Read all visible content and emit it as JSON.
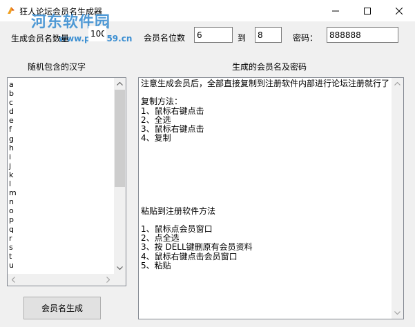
{
  "window": {
    "title": "狂人论坛会员名生成器",
    "watermark": "河东软件园",
    "watermark_url": "www.pc0359.cn"
  },
  "form": {
    "count_label": "生成会员名数量",
    "count_value": "100",
    "digits_label": "会员名位数",
    "digits_min": "6",
    "to_label": "到",
    "digits_max": "8",
    "password_label": "密码：",
    "password_value": "888888"
  },
  "left_panel": {
    "header": "随机包含的汉字",
    "items": [
      "a",
      "b",
      "c",
      "d",
      "e",
      "f",
      "g",
      "h",
      "i",
      "j",
      "k",
      "l",
      "m",
      "n",
      "o",
      "p",
      "q",
      "r",
      "s",
      "t",
      "u"
    ]
  },
  "right_panel": {
    "header": "生成的会员名及密码",
    "lines": [
      "注意生成会员后，全部直接复制到注册软件内部进行论坛注册就行了",
      "",
      "复制方法：",
      "1、鼠标右键点击",
      "2、全选",
      "3、鼠标右键点击",
      "4、复制",
      "",
      "",
      "",
      "",
      "",
      "",
      "",
      "粘贴到注册软件方法",
      "",
      "1、鼠标点会员窗口",
      "2、点全选",
      "3、按 DELL键删原有会员资料",
      "4、鼠标右键点击会员窗口",
      "5、粘贴"
    ]
  },
  "actions": {
    "generate_label": "会员名生成"
  }
}
